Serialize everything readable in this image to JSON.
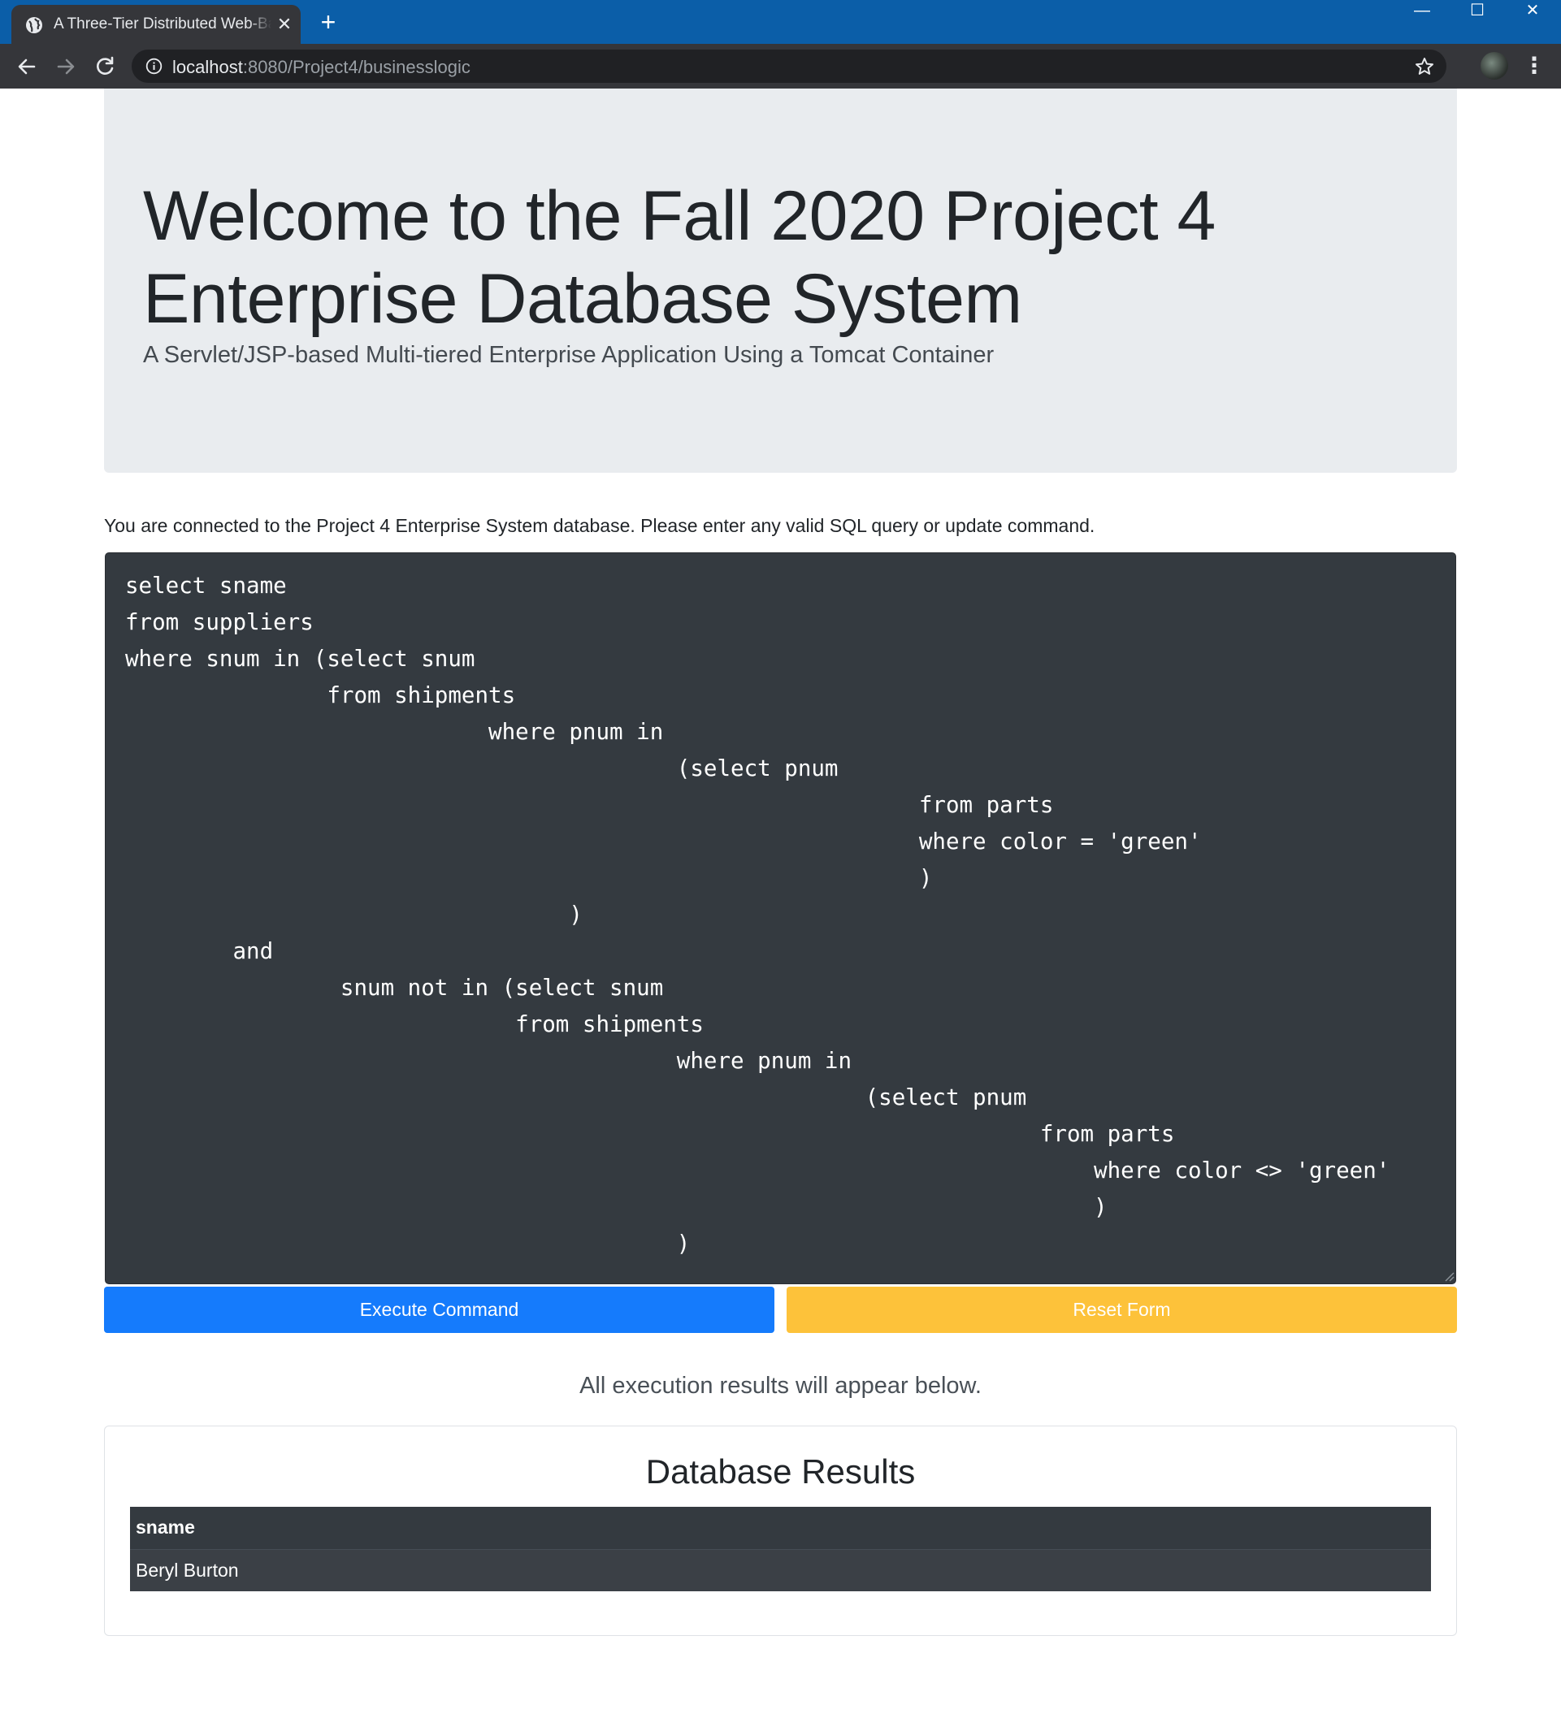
{
  "browser": {
    "tab_title": "A Three-Tier Distributed Web-Based Application",
    "tab_close": "✕",
    "new_tab": "+",
    "url_host": "localhost",
    "url_rest": ":8080/Project4/businesslogic",
    "window_controls": {
      "minimize": "—",
      "maximize": "☐",
      "close": "✕"
    },
    "menu": "⋮"
  },
  "jumbotron": {
    "title": "Welcome to the Fall 2020 Project 4 Enterprise Database System",
    "subtitle": "A Servlet/JSP-based Multi-tiered Enterprise Application Using a Tomcat Container"
  },
  "intro_text": "You are connected to the Project 4 Enterprise System database. Please enter any valid SQL query or update command.",
  "sql_command": "select sname\nfrom suppliers\nwhere snum in (select snum\n               from shipments\n                           where pnum in\n                                         (select pnum\n                                                           from parts\n                                                           where color = 'green'\n                                                           )\n                                 )\n        and\n                snum not in (select snum\n                             from shipments\n                                         where pnum in\n                                                       (select pnum\n                                                                    from parts\n                                                                        where color <> 'green'\n                                                                        )\n                                         )",
  "buttons": {
    "execute": "Execute Command",
    "reset": "Reset Form"
  },
  "results_note": "All execution results will appear below.",
  "results": {
    "title": "Database Results",
    "columns": [
      "sname"
    ],
    "rows": [
      [
        "Beryl Burton"
      ]
    ]
  },
  "colors": {
    "titlebar": "#0b5ea8",
    "execute_button": "#157bfc",
    "reset_button": "#fdc23a",
    "sql_background": "#343a40"
  }
}
